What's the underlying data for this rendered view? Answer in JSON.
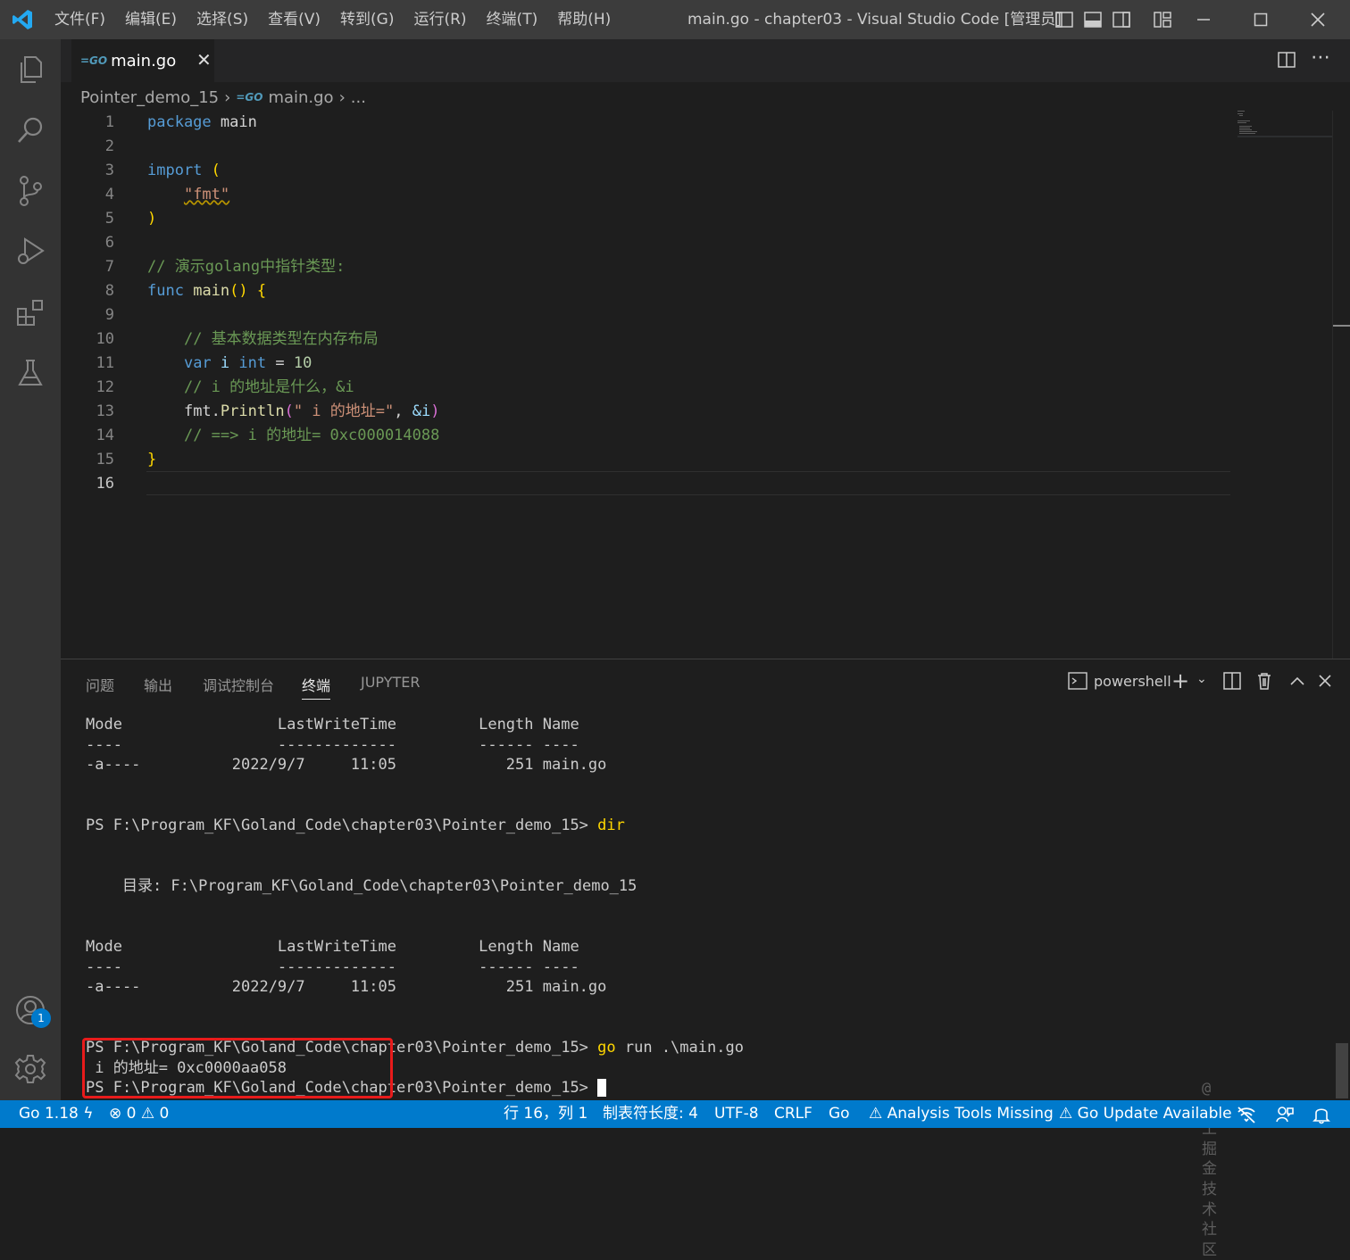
{
  "window": {
    "title": "main.go - chapter03 - Visual Studio Code [管理员]",
    "menu": [
      "文件(F)",
      "编辑(E)",
      "选择(S)",
      "查看(V)",
      "转到(G)",
      "运行(R)",
      "终端(T)",
      "帮助(H)"
    ]
  },
  "editor": {
    "tab": {
      "label": "main.go",
      "icon": "go-file-icon"
    },
    "breadcrumb": [
      "Pointer_demo_15",
      "main.go",
      "..."
    ],
    "lines": [
      "1",
      "2",
      "3",
      "4",
      "5",
      "6",
      "7",
      "8",
      "9",
      "10",
      "11",
      "12",
      "13",
      "14",
      "15",
      "16"
    ],
    "current_line": "16",
    "code": {
      "l1_kw": "package",
      "l1_name": "main",
      "l3_kw": "import",
      "l3_paren": "(",
      "l4_str": "\"fmt\"",
      "l5_paren": ")",
      "l7_comment": "// 演示golang中指针类型:",
      "l8_kw": "func",
      "l8_fn": "main",
      "l8_parens": "()",
      "l8_brace": "{",
      "l10_comment": "// 基本数据类型在内存布局",
      "l11_kw": "var",
      "l11_var": "i",
      "l11_type": "int",
      "l11_op": "=",
      "l11_num": "10",
      "l12_comment": "// i 的地址是什么，&i",
      "l13_pkg": "fmt",
      "l13_fn": "Println",
      "l13_str": "\" i 的地址=\"",
      "l13_arg": "&i",
      "l14_comment": "// ==> i 的地址= 0xc000014088",
      "l15_brace": "}"
    }
  },
  "panel": {
    "tabs": [
      "问题",
      "输出",
      "调试控制台",
      "终端",
      "JUPYTER"
    ],
    "active_tab": "终端",
    "shell": "powershell",
    "terminal": {
      "t1": "Mode                 LastWriteTime         Length Name",
      "t2": "----                 -------------         ------ ----",
      "t3": "-a----          2022/9/7     11:05            251 main.go",
      "t4_prompt": "PS F:\\Program_KF\\Goland_Code\\chapter03\\Pointer_demo_15> ",
      "t4_cmd": "dir",
      "t5": "    目录: F:\\Program_KF\\Goland_Code\\chapter03\\Pointer_demo_15",
      "t6": "Mode                 LastWriteTime         Length Name",
      "t7": "----                 -------------         ------ ----",
      "t8": "-a----          2022/9/7     11:05            251 main.go",
      "t9_prompt": "PS F:\\Program_KF\\Goland_Code\\chapter03\\Pointer_demo_15> ",
      "t9_cmd": "go",
      "t9_args": " run .\\main.go",
      "t10": " i 的地址= 0xc0000aa058",
      "t11_prompt": "PS F:\\Program_KF\\Goland_Code\\chapter03\\Pointer_demo_15> "
    },
    "watermark": "@稀土掘金技术社区"
  },
  "accounts_badge": "1",
  "statusbar": {
    "go_version": "Go 1.18",
    "errors": "0",
    "warnings": "0",
    "position": "行 16，列 1",
    "tab_size": "制表符长度: 4",
    "encoding": "UTF-8",
    "eol": "CRLF",
    "language": "Go",
    "analysis": "Analysis Tools Missing",
    "update": "Go Update Available"
  },
  "colors": {
    "accent": "#007acc",
    "highlight_box": "#e81b1b",
    "titlebar": "#3c3c3c"
  }
}
